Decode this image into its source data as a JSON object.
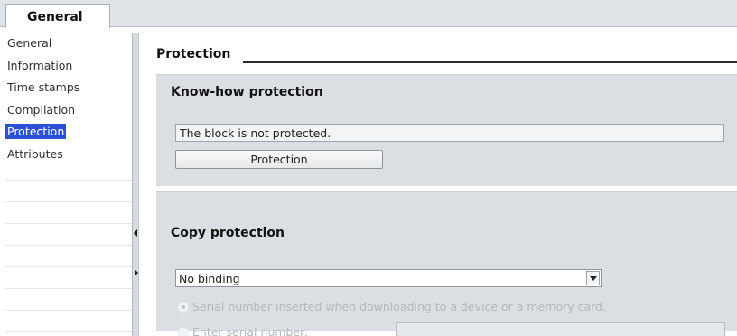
{
  "tabs": [
    {
      "label": "General",
      "active": true
    }
  ],
  "nav": {
    "items": [
      {
        "label": "General",
        "active": false
      },
      {
        "label": "Information",
        "active": false
      },
      {
        "label": "Time stamps",
        "active": false
      },
      {
        "label": "Compilation",
        "active": false
      },
      {
        "label": "Protection",
        "active": true
      },
      {
        "label": "Attributes",
        "active": false
      }
    ]
  },
  "main": {
    "section_title": "Protection",
    "knowhow": {
      "title": "Know-how protection",
      "status_text": "The block is not protected.",
      "button_label": "Protection"
    },
    "copy": {
      "title": "Copy protection",
      "binding_value": "No binding",
      "options": [
        {
          "label": "Serial number inserted when downloading to a device or a memory card.",
          "selected": true,
          "enabled": false
        },
        {
          "label": "Enter serial number:",
          "selected": false,
          "enabled": false
        }
      ],
      "serial_value": ""
    }
  },
  "colors": {
    "accent": "#2b52d6",
    "panel": "#dbdfe3",
    "disabled_text": "#b4b7bb"
  }
}
